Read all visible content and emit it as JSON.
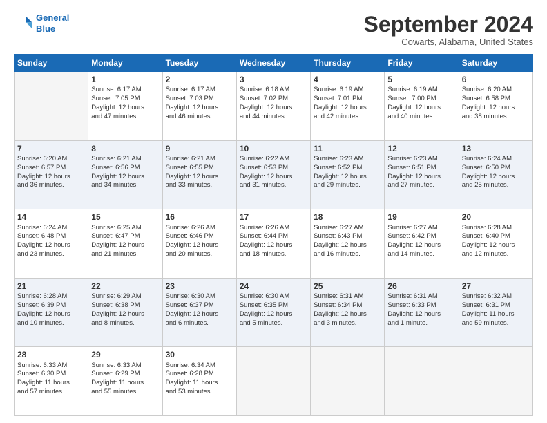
{
  "logo": {
    "line1": "General",
    "line2": "Blue"
  },
  "header": {
    "title": "September 2024",
    "subtitle": "Cowarts, Alabama, United States"
  },
  "weekdays": [
    "Sunday",
    "Monday",
    "Tuesday",
    "Wednesday",
    "Thursday",
    "Friday",
    "Saturday"
  ],
  "days": [
    {
      "num": "",
      "info": ""
    },
    {
      "num": "1",
      "info": "Sunrise: 6:17 AM\nSunset: 7:05 PM\nDaylight: 12 hours\nand 47 minutes."
    },
    {
      "num": "2",
      "info": "Sunrise: 6:17 AM\nSunset: 7:03 PM\nDaylight: 12 hours\nand 46 minutes."
    },
    {
      "num": "3",
      "info": "Sunrise: 6:18 AM\nSunset: 7:02 PM\nDaylight: 12 hours\nand 44 minutes."
    },
    {
      "num": "4",
      "info": "Sunrise: 6:19 AM\nSunset: 7:01 PM\nDaylight: 12 hours\nand 42 minutes."
    },
    {
      "num": "5",
      "info": "Sunrise: 6:19 AM\nSunset: 7:00 PM\nDaylight: 12 hours\nand 40 minutes."
    },
    {
      "num": "6",
      "info": "Sunrise: 6:20 AM\nSunset: 6:58 PM\nDaylight: 12 hours\nand 38 minutes."
    },
    {
      "num": "7",
      "info": "Sunrise: 6:20 AM\nSunset: 6:57 PM\nDaylight: 12 hours\nand 36 minutes."
    },
    {
      "num": "8",
      "info": "Sunrise: 6:21 AM\nSunset: 6:56 PM\nDaylight: 12 hours\nand 34 minutes."
    },
    {
      "num": "9",
      "info": "Sunrise: 6:21 AM\nSunset: 6:55 PM\nDaylight: 12 hours\nand 33 minutes."
    },
    {
      "num": "10",
      "info": "Sunrise: 6:22 AM\nSunset: 6:53 PM\nDaylight: 12 hours\nand 31 minutes."
    },
    {
      "num": "11",
      "info": "Sunrise: 6:23 AM\nSunset: 6:52 PM\nDaylight: 12 hours\nand 29 minutes."
    },
    {
      "num": "12",
      "info": "Sunrise: 6:23 AM\nSunset: 6:51 PM\nDaylight: 12 hours\nand 27 minutes."
    },
    {
      "num": "13",
      "info": "Sunrise: 6:24 AM\nSunset: 6:50 PM\nDaylight: 12 hours\nand 25 minutes."
    },
    {
      "num": "14",
      "info": "Sunrise: 6:24 AM\nSunset: 6:48 PM\nDaylight: 12 hours\nand 23 minutes."
    },
    {
      "num": "15",
      "info": "Sunrise: 6:25 AM\nSunset: 6:47 PM\nDaylight: 12 hours\nand 21 minutes."
    },
    {
      "num": "16",
      "info": "Sunrise: 6:26 AM\nSunset: 6:46 PM\nDaylight: 12 hours\nand 20 minutes."
    },
    {
      "num": "17",
      "info": "Sunrise: 6:26 AM\nSunset: 6:44 PM\nDaylight: 12 hours\nand 18 minutes."
    },
    {
      "num": "18",
      "info": "Sunrise: 6:27 AM\nSunset: 6:43 PM\nDaylight: 12 hours\nand 16 minutes."
    },
    {
      "num": "19",
      "info": "Sunrise: 6:27 AM\nSunset: 6:42 PM\nDaylight: 12 hours\nand 14 minutes."
    },
    {
      "num": "20",
      "info": "Sunrise: 6:28 AM\nSunset: 6:40 PM\nDaylight: 12 hours\nand 12 minutes."
    },
    {
      "num": "21",
      "info": "Sunrise: 6:28 AM\nSunset: 6:39 PM\nDaylight: 12 hours\nand 10 minutes."
    },
    {
      "num": "22",
      "info": "Sunrise: 6:29 AM\nSunset: 6:38 PM\nDaylight: 12 hours\nand 8 minutes."
    },
    {
      "num": "23",
      "info": "Sunrise: 6:30 AM\nSunset: 6:37 PM\nDaylight: 12 hours\nand 6 minutes."
    },
    {
      "num": "24",
      "info": "Sunrise: 6:30 AM\nSunset: 6:35 PM\nDaylight: 12 hours\nand 5 minutes."
    },
    {
      "num": "25",
      "info": "Sunrise: 6:31 AM\nSunset: 6:34 PM\nDaylight: 12 hours\nand 3 minutes."
    },
    {
      "num": "26",
      "info": "Sunrise: 6:31 AM\nSunset: 6:33 PM\nDaylight: 12 hours\nand 1 minute."
    },
    {
      "num": "27",
      "info": "Sunrise: 6:32 AM\nSunset: 6:31 PM\nDaylight: 11 hours\nand 59 minutes."
    },
    {
      "num": "28",
      "info": "Sunrise: 6:33 AM\nSunset: 6:30 PM\nDaylight: 11 hours\nand 57 minutes."
    },
    {
      "num": "29",
      "info": "Sunrise: 6:33 AM\nSunset: 6:29 PM\nDaylight: 11 hours\nand 55 minutes."
    },
    {
      "num": "30",
      "info": "Sunrise: 6:34 AM\nSunset: 6:28 PM\nDaylight: 11 hours\nand 53 minutes."
    },
    {
      "num": "",
      "info": ""
    },
    {
      "num": "",
      "info": ""
    },
    {
      "num": "",
      "info": ""
    },
    {
      "num": "",
      "info": ""
    },
    {
      "num": "",
      "info": ""
    }
  ]
}
